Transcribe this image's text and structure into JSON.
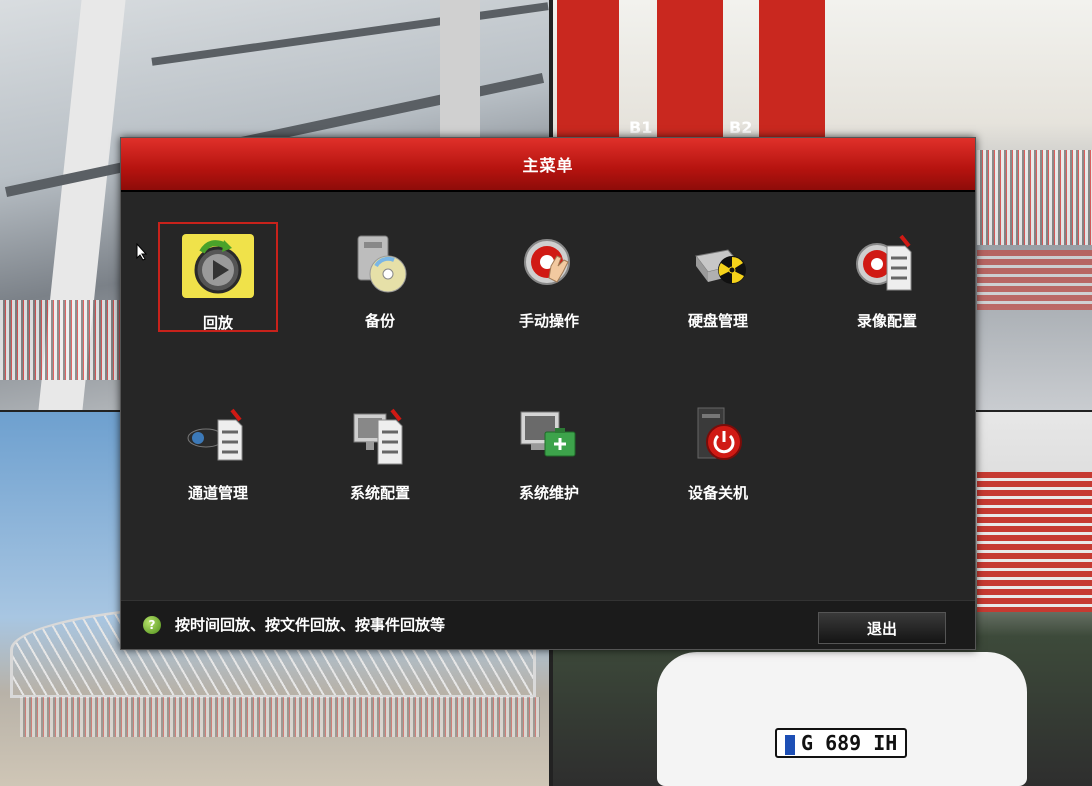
{
  "camera_views": {
    "cam2_labels": [
      "B1",
      "B2"
    ],
    "cam4_plate": "G 689 IH"
  },
  "menu": {
    "title": "主菜单",
    "items": [
      {
        "label": "回放",
        "icon": "playback-icon",
        "selected": true
      },
      {
        "label": "备份",
        "icon": "backup-disc-icon",
        "selected": false
      },
      {
        "label": "手动操作",
        "icon": "manual-record-hand-icon",
        "selected": false
      },
      {
        "label": "硬盘管理",
        "icon": "hdd-management-icon",
        "selected": false
      },
      {
        "label": "录像配置",
        "icon": "record-config-icon",
        "selected": false
      },
      {
        "label": "通道管理",
        "icon": "camera-channel-icon",
        "selected": false
      },
      {
        "label": "系统配置",
        "icon": "system-config-icon",
        "selected": false
      },
      {
        "label": "系统维护",
        "icon": "system-maintenance-icon",
        "selected": false
      },
      {
        "label": "设备关机",
        "icon": "shutdown-icon",
        "selected": false
      }
    ],
    "hint_text": "按时间回放、按文件回放、按事件回放等",
    "exit_label": "退出"
  },
  "colors": {
    "accent": "#c8221b",
    "panel": "#262626",
    "hint_icon": "#6fb22c"
  }
}
